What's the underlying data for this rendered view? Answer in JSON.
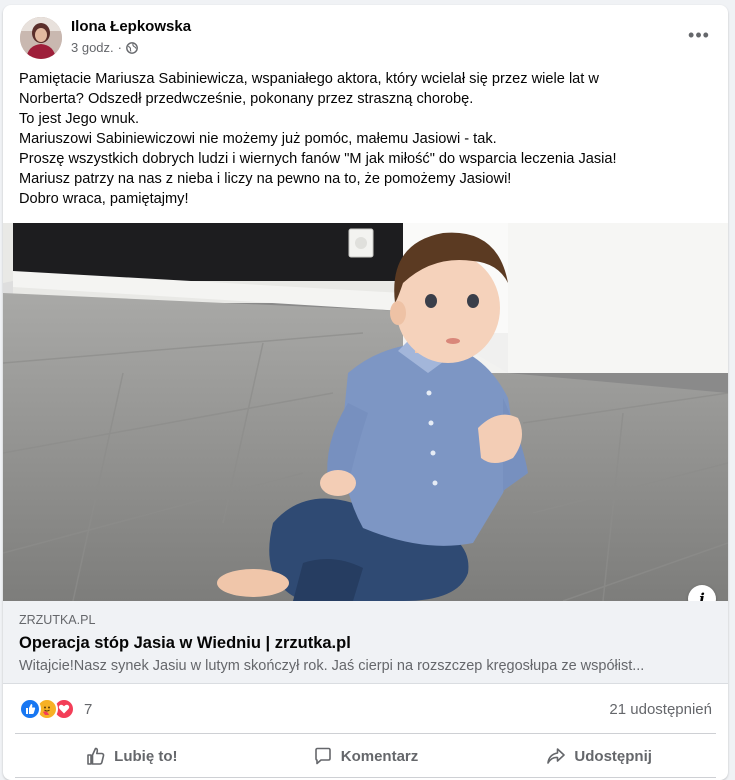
{
  "post": {
    "author": "Ilona Łepkowska",
    "timestamp": "3 godz.",
    "separator": "·",
    "privacy_icon": "globe-icon",
    "more_icon": "more-horizontal-icon",
    "more_label": "•••",
    "text_lines": [
      "Pamiętacie Mariusza Sabiniewicza, wspaniałego aktora, który wcielał się przez wiele lat w",
      "Norberta? Odszedł przedwcześnie, pokonany przez straszną chorobę.",
      "To jest Jego wnuk.",
      "Mariuszowi Sabiniewiczowi nie możemy już pomóc, małemu Jasiowi - tak.",
      "Proszę wszystkich dobrych ludzi i wiernych fanów \"M jak miłość\" do wsparcia leczenia Jasia!",
      "Mariusz patrzy na nas z nieba i liczy na pewno na to, że pomożemy Jasiowi!",
      "Dobro wraca, pamiętajmy!"
    ]
  },
  "link_preview": {
    "domain": "ZRZUTKA.PL",
    "title": "Operacja stóp Jasia w Wiedniu | zrzutka.pl",
    "description": "Witajcie!Nasz synek Jasiu w lutym skończył rok. Jaś cierpi na rozszczep kręgosłupa ze współist...",
    "info_label": "i"
  },
  "stats": {
    "reaction_icons": [
      "like-reaction-icon",
      "care-reaction-icon",
      "love-reaction-icon"
    ],
    "reaction_count": "7",
    "shares": "21 udostępnień"
  },
  "actions": {
    "like": "Lubię to!",
    "comment": "Komentarz",
    "share": "Udostępnij"
  },
  "colors": {
    "like_blue": "#1877f2",
    "care_yellow": "#f7b125",
    "love_red": "#f33e58",
    "secondary_text": "#65676b"
  }
}
